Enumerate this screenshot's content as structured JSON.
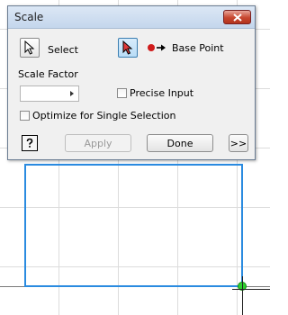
{
  "dialog": {
    "title": "Scale",
    "select_label": "Select",
    "base_point_label": "Base Point",
    "scale_factor_label": "Scale Factor",
    "scale_factor_value": "",
    "precise_input_label": "Precise Input",
    "precise_input_checked": false,
    "optimize_label": "Optimize for Single Selection",
    "optimize_checked": false,
    "apply_label": "Apply",
    "done_label": "Done",
    "expand_label": ">>",
    "help_icon": "question-help-icon"
  },
  "colors": {
    "sketch_line": "#2a8be0",
    "grip_point": "#2fd12f",
    "base_point_dot": "#d01c1c"
  }
}
